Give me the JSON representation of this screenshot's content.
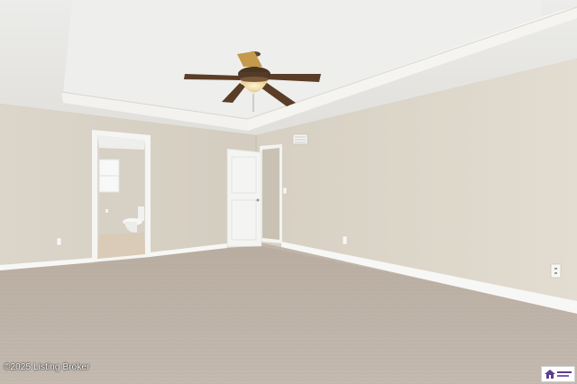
{
  "watermark": {
    "text": "©2025 Listing Broker"
  },
  "logo_badge": {
    "icon": "mls-house-logo-icon"
  },
  "colors": {
    "ceiling": "#e9e9e7",
    "wall_back": "#d9d3c6",
    "wall_right": "#dcd5c8",
    "carpet": "#bdb2a6",
    "trim": "#f7f7f5",
    "door": "#f4f4f2",
    "fan_blade": "#5a3d26",
    "fan_light": "#f2d79a"
  }
}
